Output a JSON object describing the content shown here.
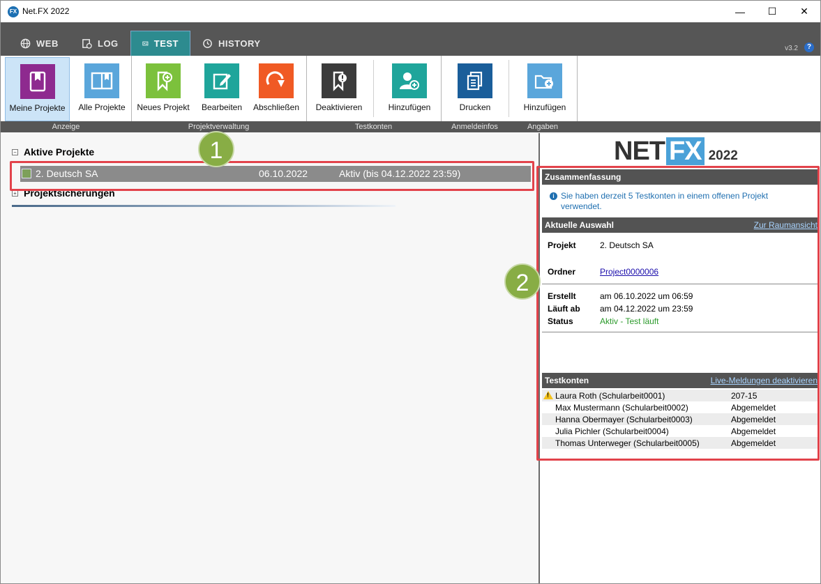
{
  "window": {
    "title": "Net.FX 2022",
    "app_icon_text": "FX",
    "minimize": "—",
    "maximize": "☐",
    "close": "✕"
  },
  "tabs": [
    {
      "label": "WEB",
      "icon": "globe-icon"
    },
    {
      "label": "LOG",
      "icon": "log-icon"
    },
    {
      "label": "TEST",
      "icon": "test-icon",
      "active": true
    },
    {
      "label": "HISTORY",
      "icon": "history-icon"
    }
  ],
  "version": "v3.2",
  "help": "?",
  "ribbon": {
    "buttons": [
      {
        "label": "Meine Projekte",
        "icon": "my-projects-icon",
        "color": "#8e2a8f",
        "selected": true
      },
      {
        "label": "Alle Projekte",
        "icon": "all-projects-icon",
        "color": "#5aa6db"
      },
      {
        "label": "Neues Projekt",
        "icon": "new-project-icon",
        "color": "#7cc13c"
      },
      {
        "label": "Bearbeiten",
        "icon": "edit-icon",
        "color": "#1fa59b"
      },
      {
        "label": "Abschließen",
        "icon": "finish-icon",
        "color": "#f05a24"
      },
      {
        "label": "Deaktivieren",
        "icon": "deactivate-icon",
        "color": "#3b3b3b"
      },
      {
        "label": "Hinzufügen",
        "icon": "add-user-icon",
        "color": "#1fa59b"
      },
      {
        "label": "Drucken",
        "icon": "print-icon",
        "color": "#1a5e9a"
      },
      {
        "label": "Hinzufügen",
        "icon": "add-folder-icon",
        "color": "#5aa6db"
      }
    ],
    "groups": [
      "Anzeige",
      "Projektverwaltung",
      "Testkonten",
      "Anmeldeinfos",
      "Angaben"
    ]
  },
  "left": {
    "active_heading": "Aktive Projekte",
    "backup_heading": "Projektsicherungen",
    "project": {
      "name": "2. Deutsch SA",
      "date": "06.10.2022",
      "status": "Aktiv (bis 04.12.2022 23:59)"
    },
    "badge": "1"
  },
  "right": {
    "logo": {
      "net": "NET",
      "fx": "FX",
      "year": "2022"
    },
    "badge": "2",
    "summary": {
      "heading": "Zusammenfassung",
      "info": "Sie haben derzeit 5 Testkonten in einem offenen Projekt verwendet."
    },
    "selection": {
      "heading": "Aktuelle Auswahl",
      "link": "Zur Raumansicht",
      "project_label": "Projekt",
      "project_value": "2. Deutsch SA",
      "folder_label": "Ordner",
      "folder_value": "Project0000006",
      "created_label": "Erstellt",
      "created_value": "am 06.10.2022 um 06:59",
      "expires_label": "Läuft ab",
      "expires_value": "am 04.12.2022 um 23:59",
      "status_label": "Status",
      "status_value": "Aktiv - Test läuft"
    },
    "accounts": {
      "heading": "Testkonten",
      "link": "Live-Meldungen deaktivieren",
      "rows": [
        {
          "name": "Laura Roth (Schularbeit0001)",
          "status": "207-15",
          "warning": true
        },
        {
          "name": "Max Mustermann (Schularbeit0002)",
          "status": "Abgemeldet"
        },
        {
          "name": "Hanna Obermayer (Schularbeit0003)",
          "status": "Abgemeldet"
        },
        {
          "name": "Julia Pichler (Schularbeit0004)",
          "status": "Abgemeldet"
        },
        {
          "name": "Thomas Unterweger (Schularbeit0005)",
          "status": "Abgemeldet"
        }
      ]
    }
  }
}
